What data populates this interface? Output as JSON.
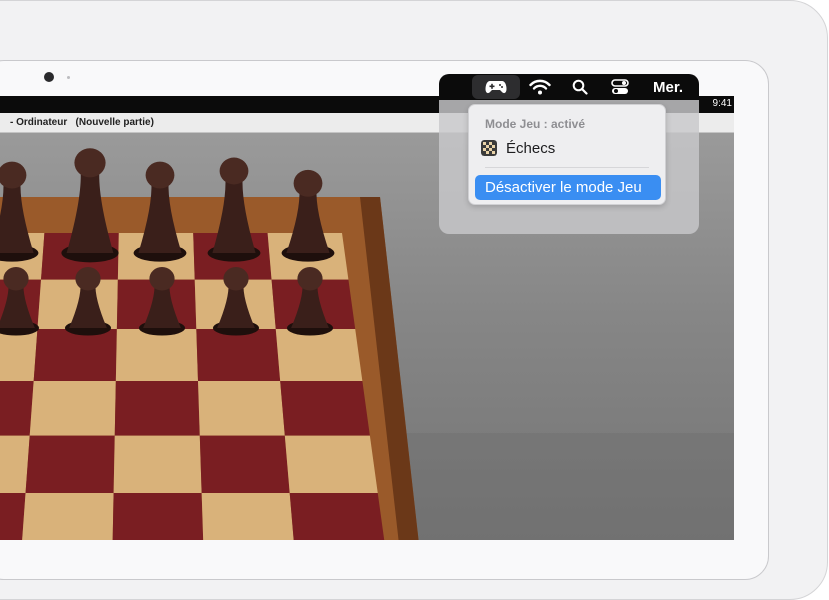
{
  "menubar": {
    "clock_text": "9:41",
    "date_label": "Mer.",
    "icons": [
      "gamepad-icon",
      "wifi-icon",
      "search-icon",
      "control-center-icon"
    ]
  },
  "window": {
    "title": "- Ordinateur   (Nouvelle partie)"
  },
  "game_mode_menu": {
    "header": "Mode Jeu : activé",
    "app_name": "Échecs",
    "app_icon": "chess-app-icon",
    "action_label": "Désactiver le mode Jeu"
  },
  "colors": {
    "accent": "#3a8ef2",
    "menubar": "#0b0b0b",
    "board_dark": "#7a1e22",
    "board_light": "#d9b27a",
    "board_frame": "#9a5a2a",
    "pieces": "#3a1f1a"
  }
}
